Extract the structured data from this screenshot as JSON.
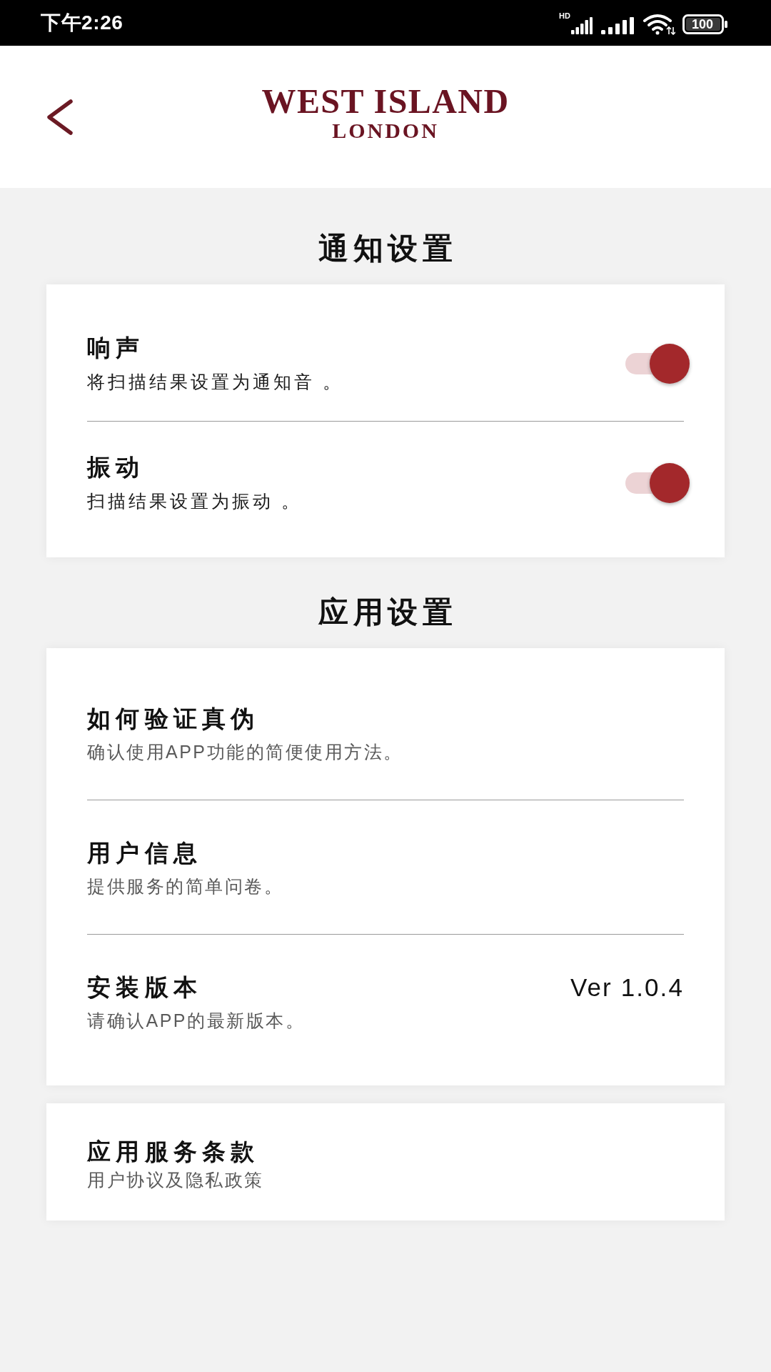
{
  "status_bar": {
    "time": "下午2:26",
    "network_label": "HD",
    "battery": "100"
  },
  "header": {
    "logo_line_1": "WEST ISLAND",
    "logo_line_2": "LONDON"
  },
  "sections": [
    {
      "title": "通知设置",
      "cards": [
        {
          "rows": [
            {
              "kind": "toggle",
              "title": "响声",
              "subtitle": "将扫描结果设置为通知音 。",
              "on": true
            },
            {
              "kind": "toggle",
              "title": "振动",
              "subtitle": "扫描结果设置为振动 。",
              "on": true
            }
          ]
        }
      ]
    },
    {
      "title": "应用设置",
      "cards": [
        {
          "rows": [
            {
              "kind": "link",
              "title": "如何验证真伪",
              "subtitle": "确认使用APP功能的简便使用方法。"
            },
            {
              "kind": "link",
              "title": "用户信息",
              "subtitle": "提供服务的简单问卷。"
            },
            {
              "kind": "version",
              "title": "安装版本",
              "value": "Ver 1.0.4",
              "subtitle": "请确认APP的最新版本。"
            }
          ]
        },
        {
          "rows": [
            {
              "kind": "link",
              "title": "应用服务条款",
              "subtitle": "用户协议及隐私政策"
            }
          ]
        }
      ]
    }
  ]
}
